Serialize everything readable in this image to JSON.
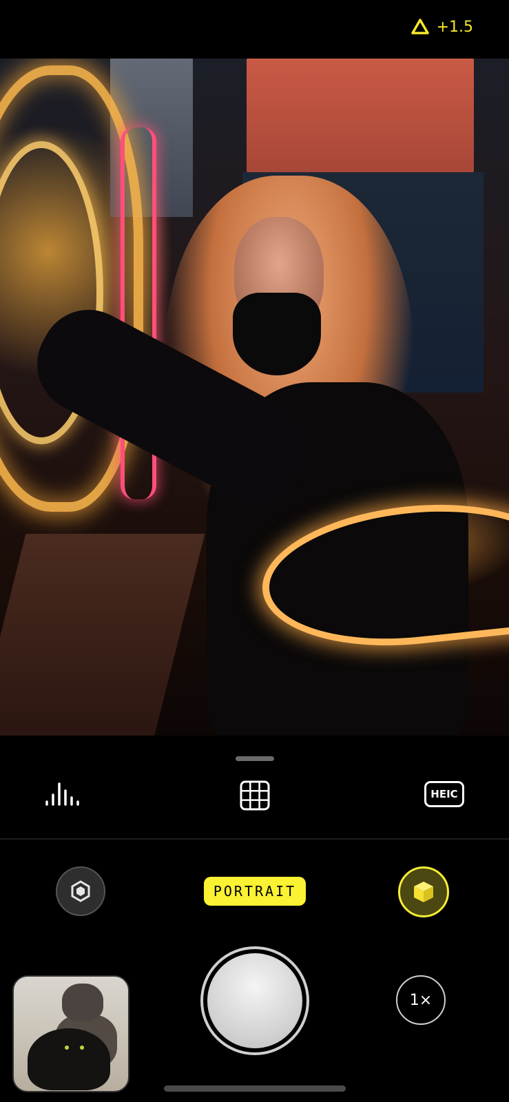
{
  "status": {
    "exposure_value": "+1.5"
  },
  "toolbar": {
    "histogram_icon": "histogram-icon",
    "grid_icon": "grid-icon",
    "format_label": "HEIC"
  },
  "modes": {
    "left_icon": "hexagon-aperture-icon",
    "current_mode": "PORTRAIT",
    "right_icon": "cube-icon"
  },
  "controls": {
    "zoom_label": "1×"
  },
  "colors": {
    "accent": "#F5EE37",
    "background": "#000000"
  }
}
